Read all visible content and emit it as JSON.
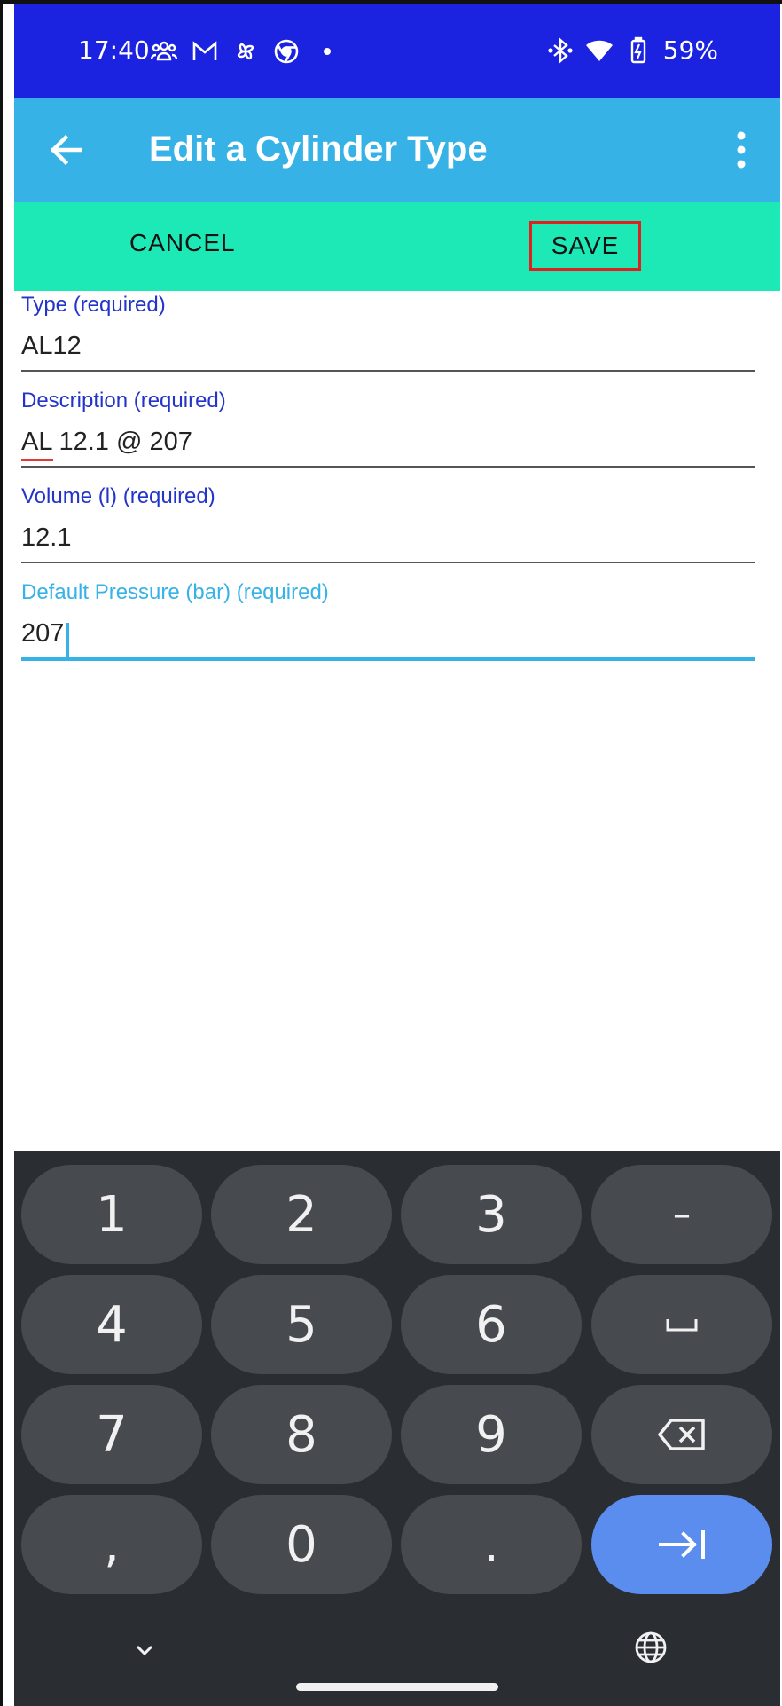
{
  "status_bar": {
    "time": "17:40",
    "battery": "59%",
    "icons_left": [
      "people-icon",
      "gmail-icon",
      "pinwheel-icon",
      "chrome-icon",
      "dot-icon"
    ],
    "icons_right": [
      "bluetooth-icon",
      "wifi-icon",
      "battery-charging-icon"
    ]
  },
  "app_bar": {
    "title": "Edit a Cylinder Type"
  },
  "actions": {
    "cancel_label": "CANCEL",
    "save_label": "SAVE"
  },
  "form": {
    "type": {
      "label": "Type (required)",
      "value": "AL12"
    },
    "description": {
      "label": "Description (required)",
      "value": "AL 12.1 @ 207"
    },
    "volume": {
      "label": "Volume (l) (required)",
      "value": "12.1"
    },
    "pressure": {
      "label": "Default Pressure (bar) (required)",
      "value": "207"
    }
  },
  "keyboard": {
    "rows": [
      [
        "1",
        "2",
        "3",
        "–"
      ],
      [
        "4",
        "5",
        "6",
        "␣"
      ],
      [
        "7",
        "8",
        "9",
        "⌫"
      ],
      [
        ",",
        "0",
        ".",
        "→|"
      ]
    ]
  },
  "colors": {
    "status_bar": "#1b22e0",
    "app_bar": "#36b2e7",
    "action_bar": "#1de9b6",
    "label": "#2334c9",
    "focus": "#36b2e7",
    "keyboard_bg": "#2a2d31",
    "key_bg": "#474a4e",
    "action_key": "#5b8def"
  }
}
